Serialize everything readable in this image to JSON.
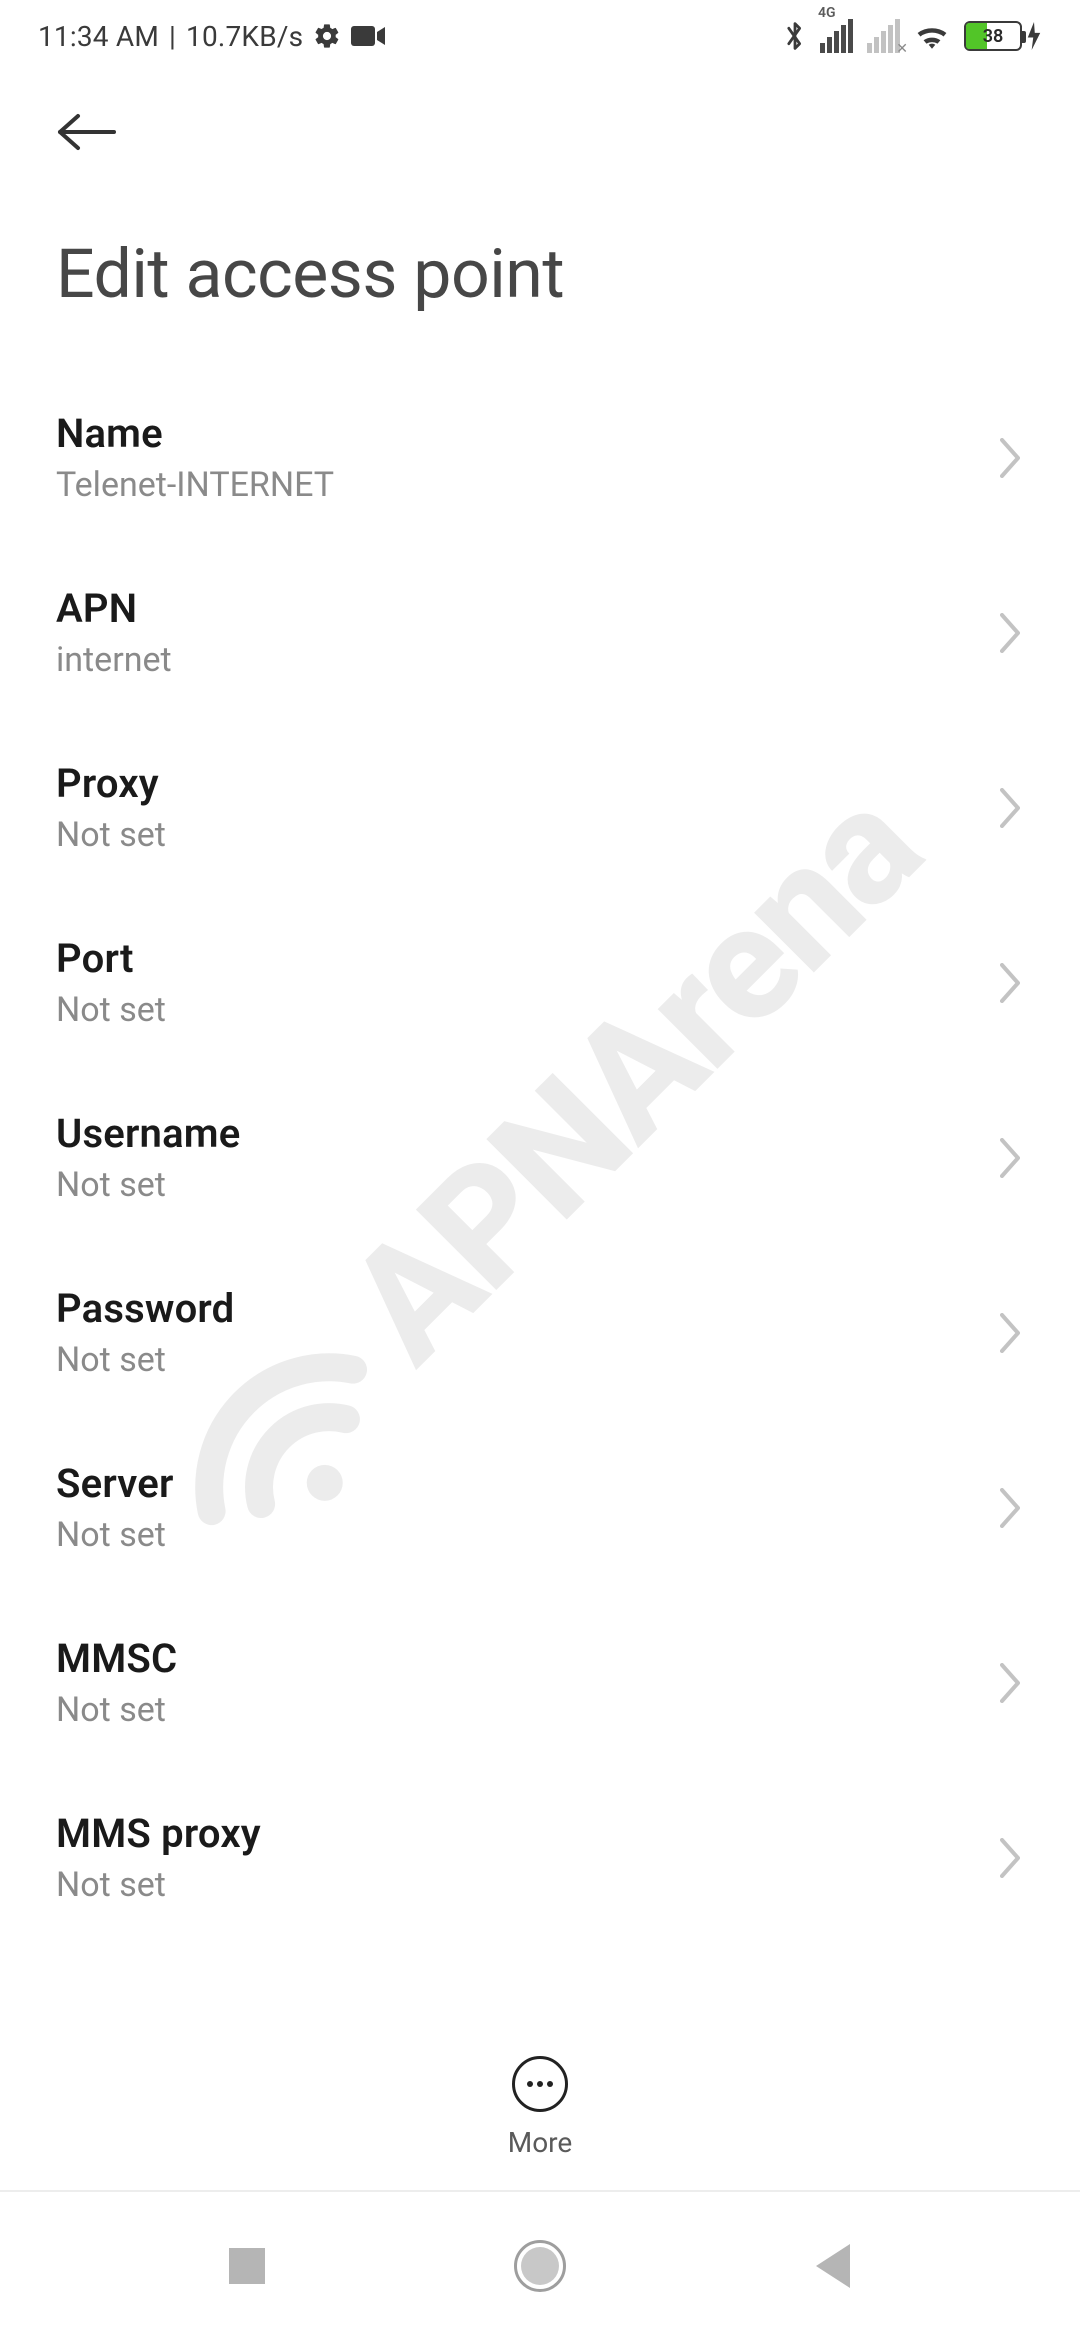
{
  "status": {
    "time": "11:34 AM",
    "separator": "|",
    "data_rate": "10.7KB/s",
    "network_badge": "4G",
    "battery_percent": "38"
  },
  "page": {
    "title": "Edit access point"
  },
  "rows": {
    "name": {
      "label": "Name",
      "value": "Telenet-INTERNET"
    },
    "apn": {
      "label": "APN",
      "value": "internet"
    },
    "proxy": {
      "label": "Proxy",
      "value": "Not set"
    },
    "port": {
      "label": "Port",
      "value": "Not set"
    },
    "username": {
      "label": "Username",
      "value": "Not set"
    },
    "password": {
      "label": "Password",
      "value": "Not set"
    },
    "server": {
      "label": "Server",
      "value": "Not set"
    },
    "mmsc": {
      "label": "MMSC",
      "value": "Not set"
    },
    "mmsproxy": {
      "label": "MMS proxy",
      "value": "Not set"
    }
  },
  "more": {
    "label": "More"
  },
  "watermark": {
    "text": "APNArena"
  }
}
